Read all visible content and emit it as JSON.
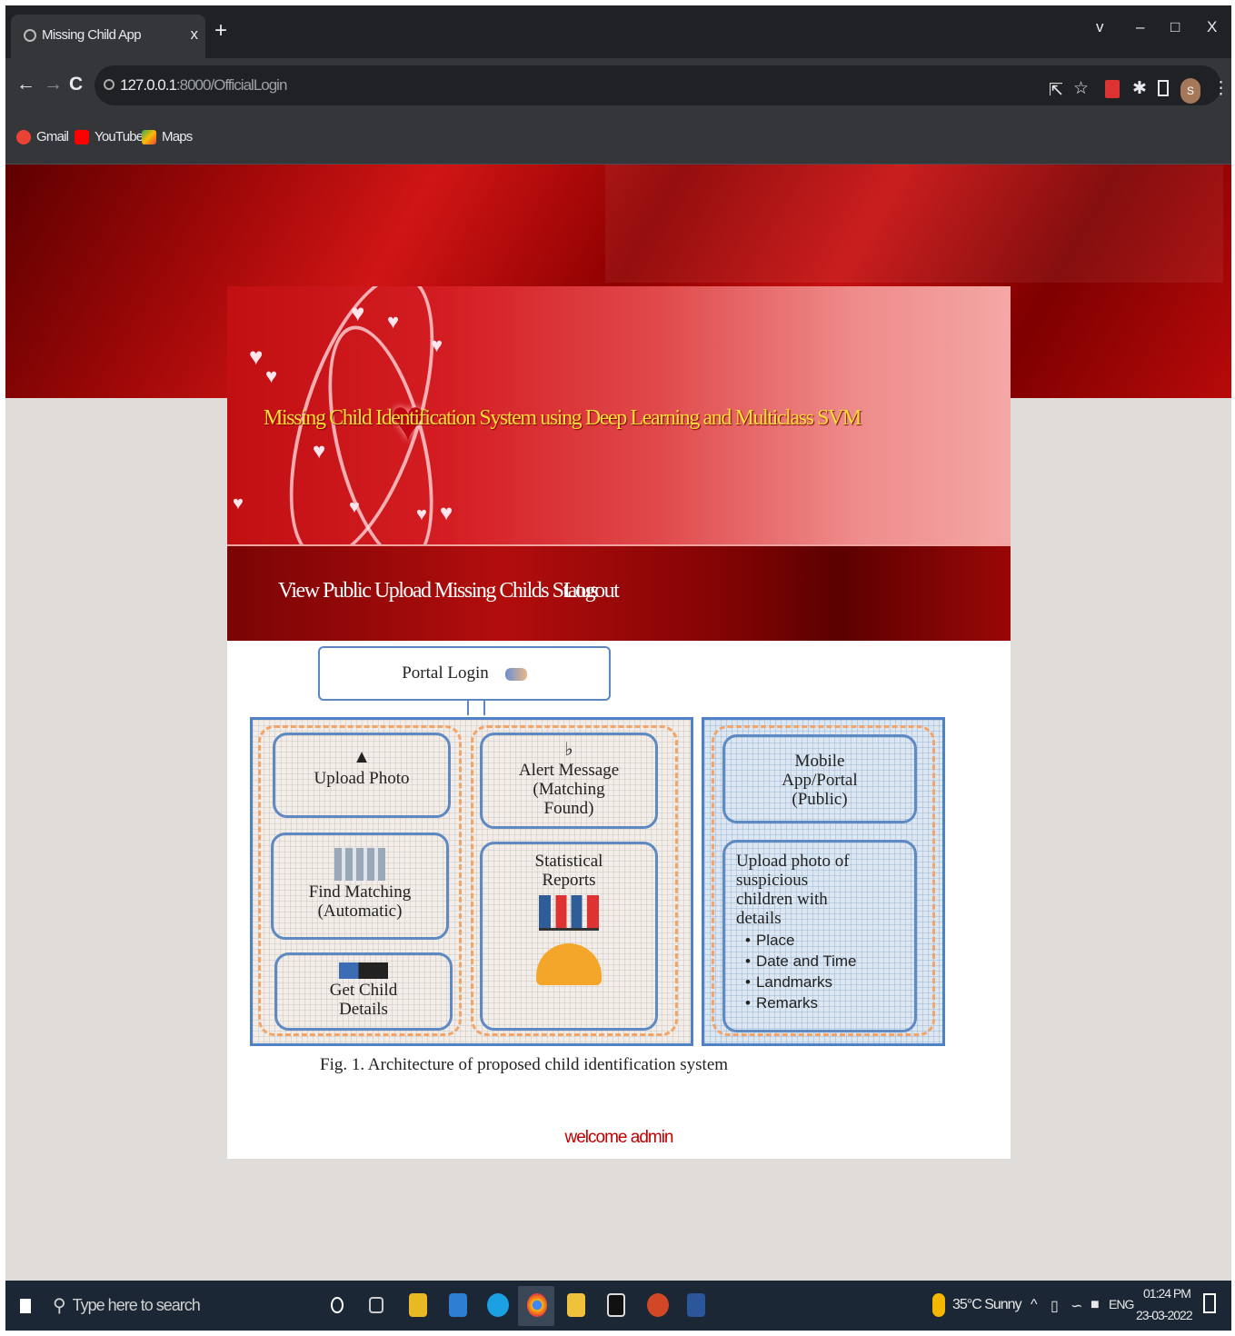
{
  "browser": {
    "tab_title": "Missing Child App",
    "tab_close": "x",
    "new_tab": "+",
    "window_controls": [
      "v",
      "–",
      "□",
      "X"
    ],
    "url_host": "127.0.0.1",
    "url_path": ":8000/OfficialLogin",
    "profile_initial": "S"
  },
  "bookmarks": [
    {
      "label": "Gmail",
      "color": "#ea4335"
    },
    {
      "label": "YouTube",
      "color": "#ff0000"
    },
    {
      "label": "Maps",
      "color": "#34a853"
    }
  ],
  "page": {
    "title": "Missing Child Identification System using Deep Learning and Multiclass SVM",
    "nav": {
      "upload_status": "View Public Upload Missing Childs Status",
      "logout": "Logout"
    },
    "figure": {
      "portal_login": "Portal Login",
      "upload_photo": "Upload Photo",
      "alert_message": [
        "Alert Message",
        "(Matching",
        "Found)"
      ],
      "find_matching": [
        "Find Matching",
        "(Automatic)"
      ],
      "statistical_reports": [
        "Statistical",
        "Reports"
      ],
      "get_child_details": [
        "Get Child",
        "Details"
      ],
      "mobile_app": [
        "Mobile",
        "App/Portal",
        "(Public)"
      ],
      "upload_suspicious": [
        "Upload photo of",
        "suspicious",
        "children with",
        "details"
      ],
      "suspicious_details": [
        "Place",
        "Date and Time",
        "Landmarks",
        "Remarks"
      ],
      "caption": "Fig. 1.   Architecture of proposed child identification system"
    },
    "welcome": "welcome admin"
  },
  "taskbar": {
    "search_placeholder": "Type here to search",
    "weather": "35°C Sunny",
    "language": "ENG",
    "time": "01:24 PM",
    "date": "23-03-2022"
  }
}
